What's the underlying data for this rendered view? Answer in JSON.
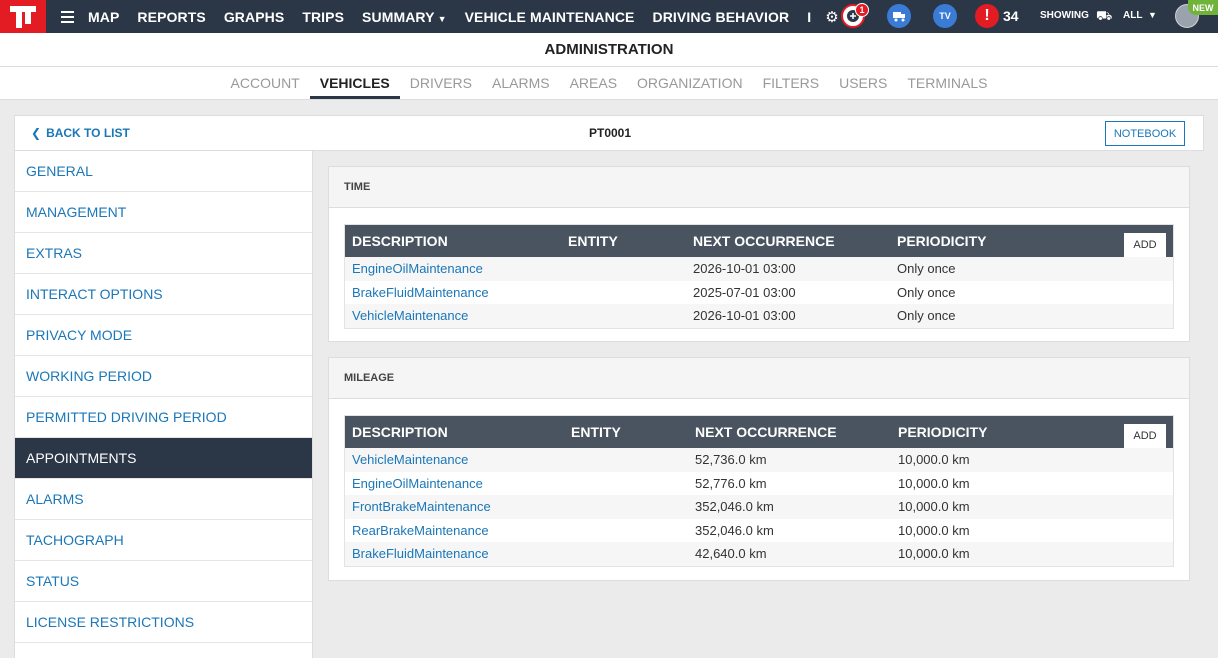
{
  "topbar": {
    "nav": [
      "MAP",
      "REPORTS",
      "GRAPHS",
      "TRIPS",
      "SUMMARY",
      "VEHICLE MAINTENANCE",
      "DRIVING BEHAVIOR",
      "I"
    ],
    "messages_badge": "1",
    "alert_count": "34",
    "showing_label": "SHOWING",
    "showing_value": "ALL",
    "new_badge": "NEW",
    "tv_label": "TV"
  },
  "header": {
    "title": "ADMINISTRATION",
    "tabs": [
      "ACCOUNT",
      "VEHICLES",
      "DRIVERS",
      "ALARMS",
      "AREAS",
      "ORGANIZATION",
      "FILTERS",
      "USERS",
      "TERMINALS"
    ],
    "active_tab": "VEHICLES"
  },
  "record": {
    "back_label": "BACK TO LIST",
    "id": "PT0001",
    "notebook_label": "NOTEBOOK"
  },
  "sidebar": {
    "items": [
      "GENERAL",
      "MANAGEMENT",
      "EXTRAS",
      "INTERACT OPTIONS",
      "PRIVACY MODE",
      "WORKING PERIOD",
      "PERMITTED DRIVING PERIOD",
      "APPOINTMENTS",
      "ALARMS",
      "TACHOGRAPH",
      "STATUS",
      "LICENSE RESTRICTIONS"
    ],
    "active": "APPOINTMENTS"
  },
  "time_panel": {
    "title": "TIME",
    "columns": [
      "DESCRIPTION",
      "ENTITY",
      "NEXT OCCURRENCE",
      "PERIODICITY"
    ],
    "add_label": "ADD",
    "rows": [
      {
        "description": "EngineOilMaintenance",
        "entity": "",
        "next": "2026-10-01 03:00",
        "periodicity": "Only once"
      },
      {
        "description": "BrakeFluidMaintenance",
        "entity": "",
        "next": "2025-07-01 03:00",
        "periodicity": "Only once"
      },
      {
        "description": "VehicleMaintenance",
        "entity": "",
        "next": "2026-10-01 03:00",
        "periodicity": "Only once"
      }
    ]
  },
  "mileage_panel": {
    "title": "MILEAGE",
    "columns": [
      "DESCRIPTION",
      "ENTITY",
      "NEXT OCCURRENCE",
      "PERIODICITY"
    ],
    "add_label": "ADD",
    "rows": [
      {
        "description": "VehicleMaintenance",
        "entity": "",
        "next": "52,736.0 km",
        "periodicity": "10,000.0 km"
      },
      {
        "description": "EngineOilMaintenance",
        "entity": "",
        "next": "52,776.0 km",
        "periodicity": "10,000.0 km"
      },
      {
        "description": "FrontBrakeMaintenance",
        "entity": "",
        "next": "352,046.0 km",
        "periodicity": "10,000.0 km"
      },
      {
        "description": "RearBrakeMaintenance",
        "entity": "",
        "next": "352,046.0 km",
        "periodicity": "10,000.0 km"
      },
      {
        "description": "BrakeFluidMaintenance",
        "entity": "",
        "next": "42,640.0 km",
        "periodicity": "10,000.0 km"
      }
    ]
  },
  "colors": {
    "topbar": "#2b3646",
    "logo": "#e31b23",
    "link": "#1a77b8",
    "table_header": "#4a5461",
    "new_badge": "#6fb33b"
  }
}
